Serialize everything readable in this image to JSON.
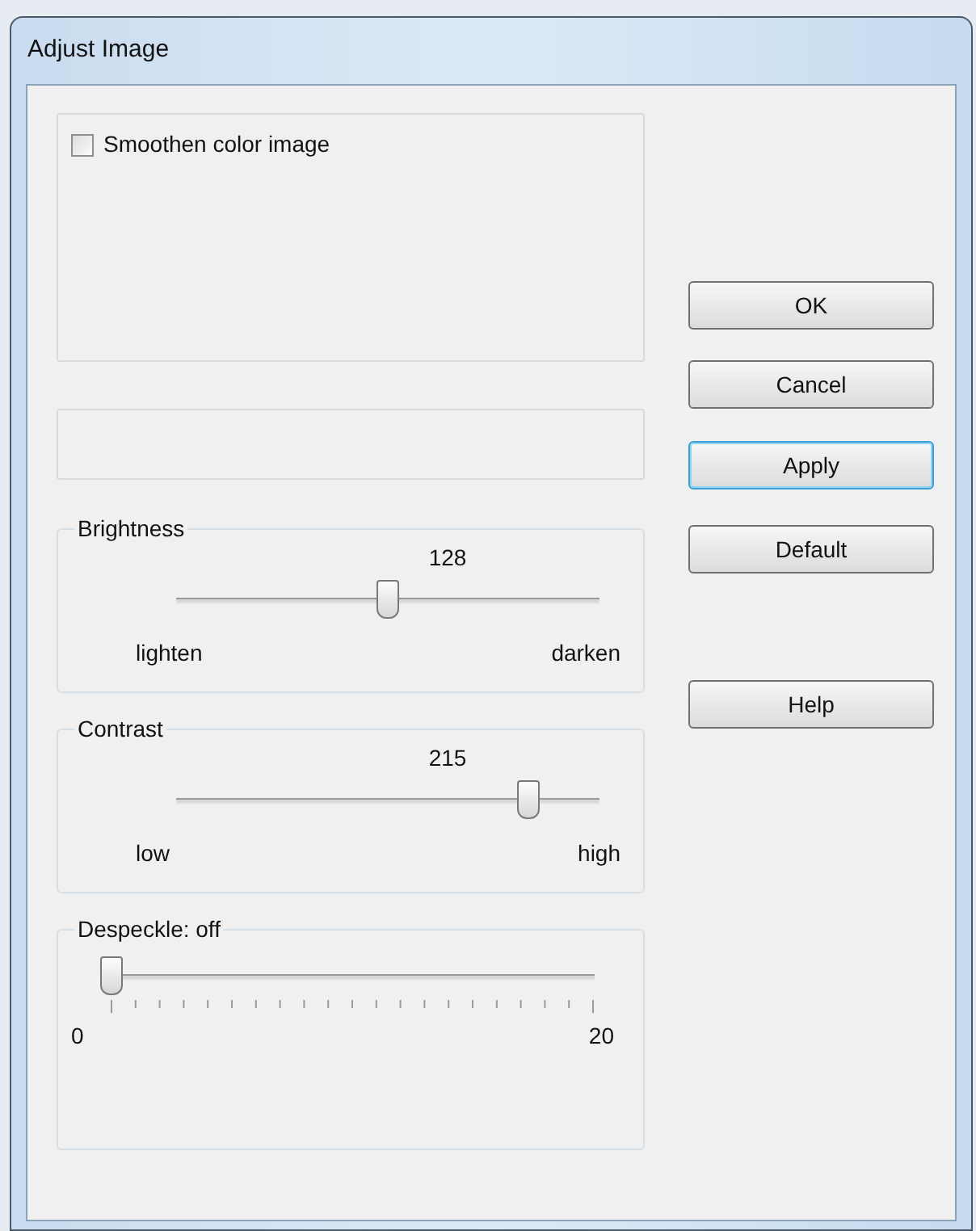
{
  "window": {
    "title": "Adjust Image"
  },
  "smoothen": {
    "label": "Smoothen color image",
    "checked": false
  },
  "sliders": [
    {
      "kind": "labeled",
      "title": "Brightness",
      "value": "128",
      "level": 0.5,
      "min_label": "lighten",
      "max_label": "darken"
    },
    {
      "kind": "labeled",
      "title": "Contrast",
      "value": "215",
      "level": 0.85,
      "min_label": "low",
      "max_label": "high"
    },
    {
      "kind": "ticked",
      "title": "Despeckle: off",
      "level": 0,
      "min_label": "0",
      "max_label": "20"
    }
  ],
  "buttons": [
    {
      "label": "OK",
      "default": false
    },
    {
      "label": "Cancel",
      "default": false
    },
    {
      "label": "Apply",
      "default": true
    },
    {
      "label": "Default",
      "default": false
    },
    {
      "label": "Help",
      "default": false
    }
  ]
}
